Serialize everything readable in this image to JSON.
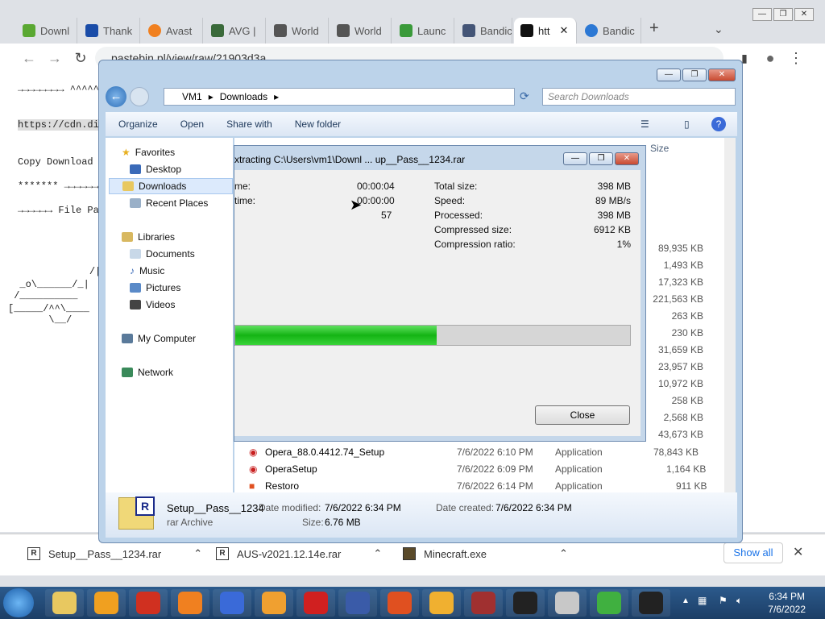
{
  "chrome": {
    "tabs": [
      {
        "label": "Downl",
        "color": "#5aa832"
      },
      {
        "label": "Thank",
        "color": "#1a4ca8"
      },
      {
        "label": "Avast",
        "color": "#f08020"
      },
      {
        "label": "AVG |",
        "color": "#3a6a3a"
      },
      {
        "label": "World",
        "color": "#555555"
      },
      {
        "label": "World",
        "color": "#555555"
      },
      {
        "label": "Launc",
        "color": "#3a9a3a"
      },
      {
        "label": "Bandic",
        "color": "#445577"
      },
      {
        "label": "htt",
        "color": "#111111"
      },
      {
        "label": "Bandic",
        "color": "#2c78d4"
      }
    ],
    "address": "pastebin.pl/view/raw/21903d3a"
  },
  "page_text": [
    "→→→→→→→→ ^^^^^",
    "https://cdn.di",
    "Copy Download",
    "******* →→→→→→",
    "→→→→→→ File Pa",
    "              /|",
    "  _o\\______/_|",
    " /__________",
    "[_____/^^\\____",
    "       \\__/"
  ],
  "downloads": [
    {
      "name": "Setup__Pass__1234.rar",
      "icon": "R"
    },
    {
      "name": "AUS-v2021.12.14e.rar",
      "icon": "R"
    },
    {
      "name": "Minecraft.exe",
      "icon": "M"
    }
  ],
  "show_all": "Show all",
  "explorer": {
    "breadcrumb": [
      "VM1",
      "Downloads"
    ],
    "search_placeholder": "Search Downloads",
    "commands": [
      "Organize",
      "Open",
      "Share with",
      "New folder"
    ],
    "nav": {
      "favorites": "Favorites",
      "desktop": "Desktop",
      "downloads": "Downloads",
      "recent": "Recent Places",
      "libraries": "Libraries",
      "documents": "Documents",
      "music": "Music",
      "pictures": "Pictures",
      "videos": "Videos",
      "computer": "My Computer",
      "network": "Network"
    },
    "size_header": "Size",
    "sizes": [
      "89,935 KB",
      "1,493 KB",
      "17,323 KB",
      "221,563 KB",
      "263 KB",
      "230 KB",
      "31,659 KB",
      "23,957 KB",
      "10,972 KB",
      "258 KB",
      "2,568 KB",
      "43,673 KB"
    ],
    "files": [
      {
        "name": "Opera_88.0.4412.74_Setup",
        "date": "7/6/2022 6:10 PM",
        "type": "Application",
        "size": "78,843 KB"
      },
      {
        "name": "OperaSetup",
        "date": "7/6/2022 6:09 PM",
        "type": "Application",
        "size": "1,164 KB"
      },
      {
        "name": "Restoro",
        "date": "7/6/2022 6:14 PM",
        "type": "Application",
        "size": "911 KB"
      }
    ],
    "details": {
      "name": "Setup__Pass__1234",
      "type": "rar Archive",
      "modified_label": "Date modified:",
      "modified": "7/6/2022 6:34 PM",
      "created_label": "Date created:",
      "created": "7/6/2022 6:34 PM",
      "size_label": "Size:",
      "size": "6.76 MB"
    }
  },
  "dialog": {
    "title": "xtracting C:\\Users\\vm1\\Downl ... up__Pass__1234.rar",
    "elapsed_label": "me:",
    "elapsed": "00:00:04",
    "remaining_label": "time:",
    "remaining": "00:00:00",
    "files": "57",
    "total_size_label": "Total size:",
    "total_size": "398 MB",
    "speed_label": "Speed:",
    "speed": "89 MB/s",
    "processed_label": "Processed:",
    "processed": "398 MB",
    "compressed_label": "Compressed size:",
    "compressed": "6912 KB",
    "ratio_label": "Compression ratio:",
    "ratio": "1%",
    "progress": 0.51,
    "close_label": "Close"
  },
  "taskbar": {
    "time": "6:34 PM",
    "date": "7/6/2022",
    "apps": [
      {
        "name": "explorer",
        "color": "#e8c860"
      },
      {
        "name": "media",
        "color": "#f0a020"
      },
      {
        "name": "chrome",
        "color": "#d03020"
      },
      {
        "name": "avast",
        "color": "#f08020"
      },
      {
        "name": "shield",
        "color": "#3a6ad8"
      },
      {
        "name": "avg",
        "color": "#f0a030"
      },
      {
        "name": "opera",
        "color": "#d02020"
      },
      {
        "name": "facebook",
        "color": "#3a5ba8"
      },
      {
        "name": "office",
        "color": "#e05020"
      },
      {
        "name": "lock",
        "color": "#f0b030"
      },
      {
        "name": "tools",
        "color": "#a03030"
      },
      {
        "name": "bandicam",
        "color": "#222222"
      },
      {
        "name": "hat",
        "color": "#c8c8c8"
      },
      {
        "name": "alien",
        "color": "#40b040"
      },
      {
        "name": "7zip",
        "color": "#222222"
      }
    ]
  }
}
